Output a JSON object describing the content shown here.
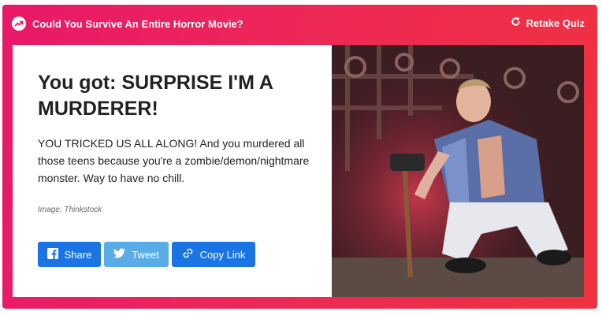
{
  "header": {
    "quiz_title": "Could You Survive An Entire Horror Movie?",
    "retake_label": "Retake Quiz"
  },
  "result": {
    "title": "You got: SURPRISE I'M A MURDERER!",
    "description": "YOU TRICKED US ALL ALONG! And you murdered all those teens because you're a zombie/demon/nightmare monster. Way to have no chill.",
    "image_credit": "Image: Thinkstock"
  },
  "share": {
    "share_label": "Share",
    "tweet_label": "Tweet",
    "copy_label": "Copy Link"
  },
  "colors": {
    "gradient_start": "#e8186a",
    "gradient_end": "#f0323f",
    "facebook": "#1b74e4",
    "twitter": "#5aace8",
    "copy_link": "#1b74e4"
  },
  "icons": [
    "trending-icon",
    "refresh-icon",
    "facebook-icon",
    "twitter-icon",
    "link-icon"
  ]
}
